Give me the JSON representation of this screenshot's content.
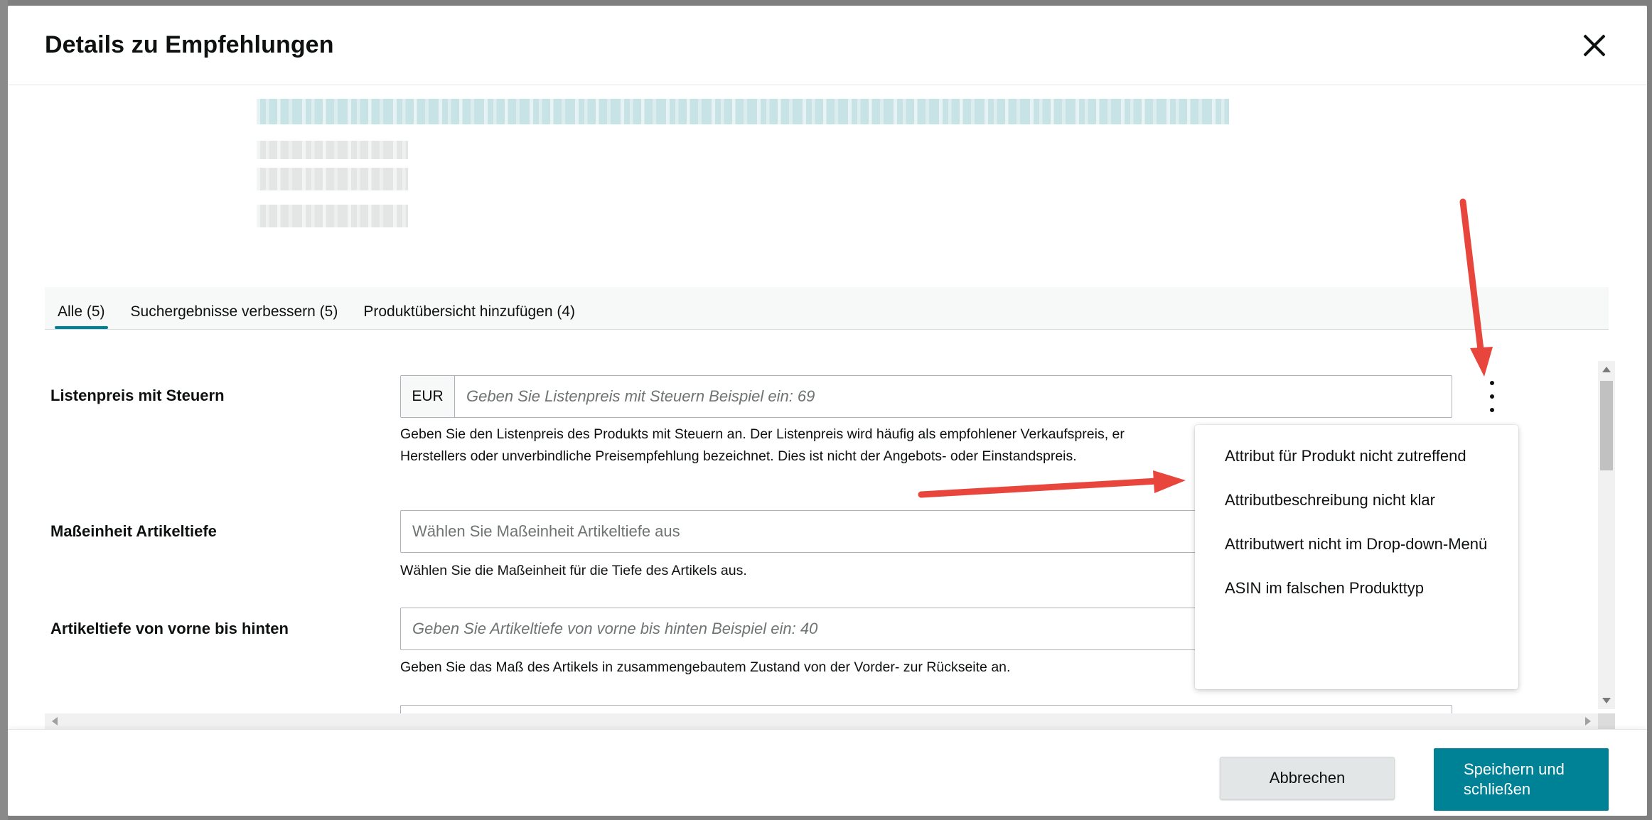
{
  "modal": {
    "title": "Details zu Empfehlungen"
  },
  "tabs": [
    {
      "label": "Alle (5)",
      "active": true
    },
    {
      "label": "Suchergebnisse verbessern (5)",
      "active": false
    },
    {
      "label": "Produktübersicht hinzufügen (4)",
      "active": false
    }
  ],
  "fields": {
    "list_price": {
      "label": "Listenpreis mit Steuern",
      "currency": "EUR",
      "placeholder": "Geben Sie Listenpreis mit Steuern Beispiel ein: 69",
      "help_line1": "Geben Sie den Listenpreis des Produkts mit Steuern an. Der Listenpreis wird häufig als empfohlener Verkaufspreis, er",
      "help_line2": "Herstellers oder unverbindliche Preisempfehlung bezeichnet. Dies ist nicht der Angebots- oder Einstandspreis."
    },
    "depth_unit": {
      "label": "Maßeinheit Artikeltiefe",
      "placeholder": "Wählen Sie Maßeinheit Artikeltiefe aus",
      "help": "Wählen Sie die Maßeinheit für die Tiefe des Artikels aus."
    },
    "depth": {
      "label": "Artikeltiefe von vorne bis hinten",
      "placeholder": "Geben Sie Artikeltiefe von vorne bis hinten Beispiel ein: 40",
      "help": "Geben Sie das Maß des Artikels in zusammengebautem Zustand von der Vorder- zur Rückseite an."
    }
  },
  "menu": {
    "items": [
      "Attribut für Produkt nicht zutreffend",
      "Attributbeschreibung nicht klar",
      "Attributwert nicht im Drop-down-Menü",
      "ASIN im falschen Produkttyp"
    ]
  },
  "footer": {
    "cancel_label": "Abbrechen",
    "save_label": "Speichern und schließen"
  },
  "colors": {
    "accent": "#008296",
    "annotation_arrow": "#e8453c"
  }
}
